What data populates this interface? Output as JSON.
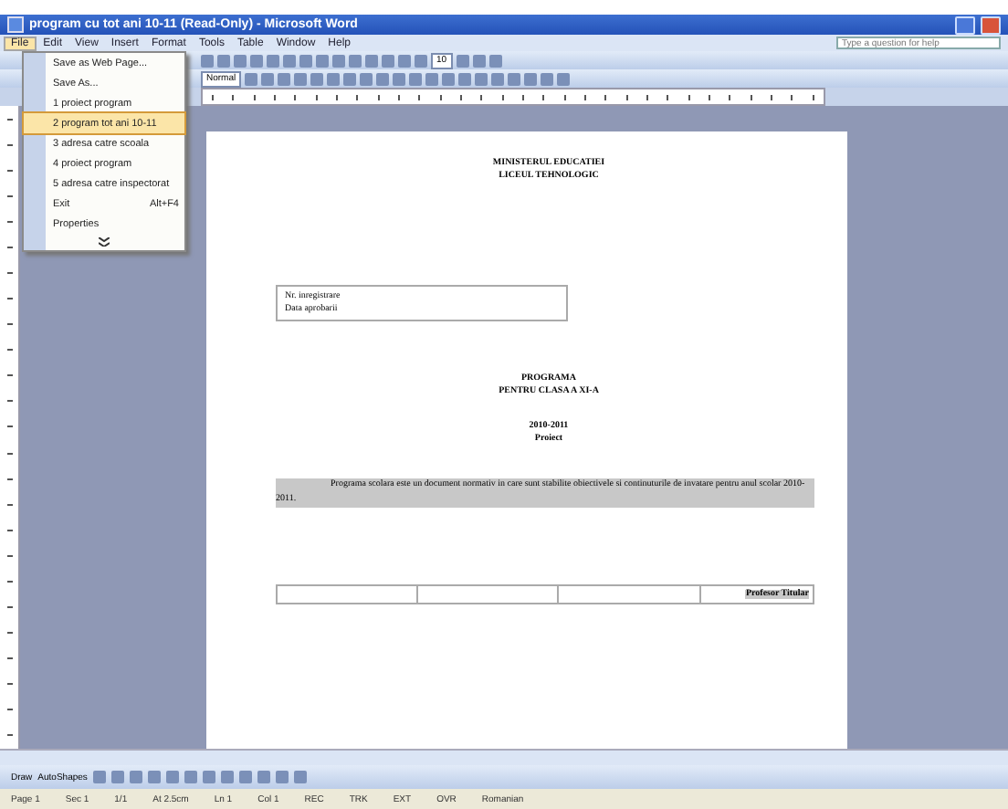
{
  "window": {
    "title": "program cu tot ani 10-11 (Read-Only) - Microsoft Word"
  },
  "help_box": {
    "placeholder": "Type a question for help"
  },
  "menu_bar": [
    {
      "label": "File",
      "selected": true
    },
    {
      "label": "Edit",
      "selected": false
    },
    {
      "label": "View",
      "selected": false
    },
    {
      "label": "Insert",
      "selected": false
    },
    {
      "label": "Format",
      "selected": false
    },
    {
      "label": "Tools",
      "selected": false
    },
    {
      "label": "Table",
      "selected": false
    },
    {
      "label": "Window",
      "selected": false
    },
    {
      "label": "Help",
      "selected": false
    }
  ],
  "file_menu": [
    {
      "label": "Save as Web Page...",
      "selected": false
    },
    {
      "label": "Save As...",
      "selected": false
    },
    {
      "label": "1 proiect program",
      "selected": false
    },
    {
      "label": "2 program tot ani 10-11",
      "selected": true
    },
    {
      "label": "3 adresa catre scoala",
      "selected": false
    },
    {
      "label": "4 proiect program",
      "selected": false
    },
    {
      "label": "5 adresa catre inspectorat",
      "selected": false
    },
    {
      "label": "Exit",
      "shortcut": "Alt+F4",
      "selected": false
    },
    {
      "label": "Properties",
      "selected": false
    }
  ],
  "toolbar": {
    "font_size": "10",
    "style": "Normal"
  },
  "document": {
    "heading": [
      "MINISTERUL EDUCATIEI",
      "LICEUL TEHNOLOGIC"
    ],
    "info_box": [
      "Nr. inregistrare",
      "Data aprobarii"
    ],
    "title": [
      "PROGRAMA",
      "PENTRU CLASA A XI-A"
    ],
    "subtitle": [
      "2010-2011",
      "Proiect"
    ],
    "paragraph": "Programa scolara este un document normativ in care sunt stabilite obiectivele si continuturile de invatare pentru anul scolar 2010-2011.",
    "table_cells": [
      "",
      "",
      "",
      "Profesor Titular"
    ]
  },
  "drawing_toolbar": [
    "Draw",
    "AutoShapes"
  ],
  "status_bar": [
    "Page 1",
    "Sec 1",
    "1/1",
    "At 2.5cm",
    "Ln 1",
    "Col 1",
    "REC",
    "TRK",
    "EXT",
    "OVR",
    "Romanian"
  ]
}
